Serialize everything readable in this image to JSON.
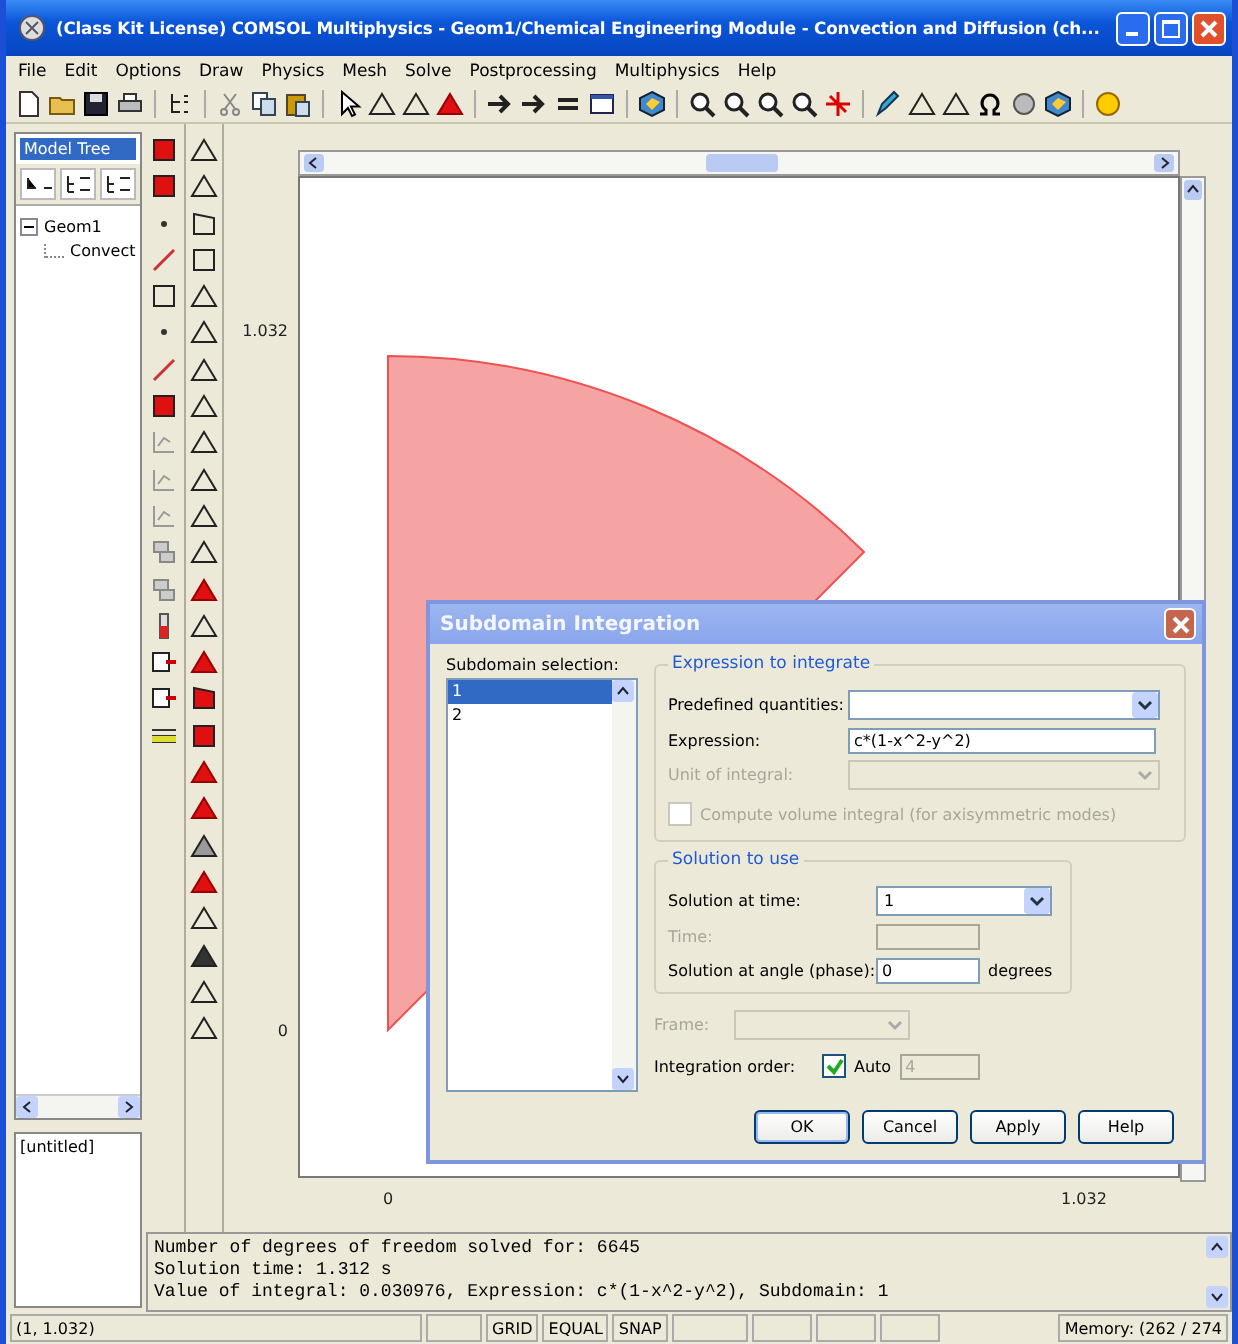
{
  "window": {
    "title": "(Class Kit License) COMSOL Multiphysics - Geom1/Chemical Engineering Module - Convection and Diffusion (ch..."
  },
  "menu": [
    "File",
    "Edit",
    "Options",
    "Draw",
    "Physics",
    "Mesh",
    "Solve",
    "Postprocessing",
    "Multiphysics",
    "Help"
  ],
  "model_tree": {
    "title": "Model Tree",
    "items": [
      {
        "label": "Geom1",
        "expanded": true,
        "children": [
          {
            "label": "Convect"
          }
        ]
      }
    ]
  },
  "projects": [
    "[untitled]"
  ],
  "plot": {
    "y_ticks": [
      "1.032",
      "0"
    ],
    "x_ticks": [
      "0",
      "1.032"
    ]
  },
  "log": [
    "Number of degrees of freedom solved for: 6645",
    "Solution time: 1.312 s",
    "Value of integral: 0.030976, Expression: c*(1-x^2-y^2), Subdomain: 1"
  ],
  "status_bar": {
    "coordinates": "(1, 1.032)",
    "toggles": [
      "GRID",
      "EQUAL",
      "SNAP"
    ],
    "memory": "Memory: (262 / 274"
  },
  "dialog": {
    "title": "Subdomain Integration",
    "selection_label": "Subdomain selection:",
    "subdomains": [
      {
        "label": "1",
        "selected": true
      },
      {
        "label": "2",
        "selected": false
      }
    ],
    "expression_group": {
      "title": "Expression to integrate",
      "predefined_label": "Predefined quantities:",
      "expression_label": "Expression:",
      "expression": "c*(1-x^2-y^2)",
      "unit_label": "Unit of integral:",
      "unit_disabled": true,
      "volume_label": "Compute volume integral (for axisymmetric modes)",
      "volume_checked": false,
      "volume_disabled": true
    },
    "solution_group": {
      "title": "Solution to use",
      "time_label": "Solution at time:",
      "time": "1",
      "time_field_label": "Time:",
      "time_field_disabled": true,
      "angle_label": "Solution at angle (phase):",
      "angle": "0",
      "angle_unit": "degrees"
    },
    "frame_label": "Frame:",
    "frame_disabled": true,
    "order_label": "Integration order:",
    "auto_label": "Auto",
    "auto_checked": true,
    "order": "4",
    "buttons": [
      "OK",
      "Cancel",
      "Apply",
      "Help"
    ]
  }
}
